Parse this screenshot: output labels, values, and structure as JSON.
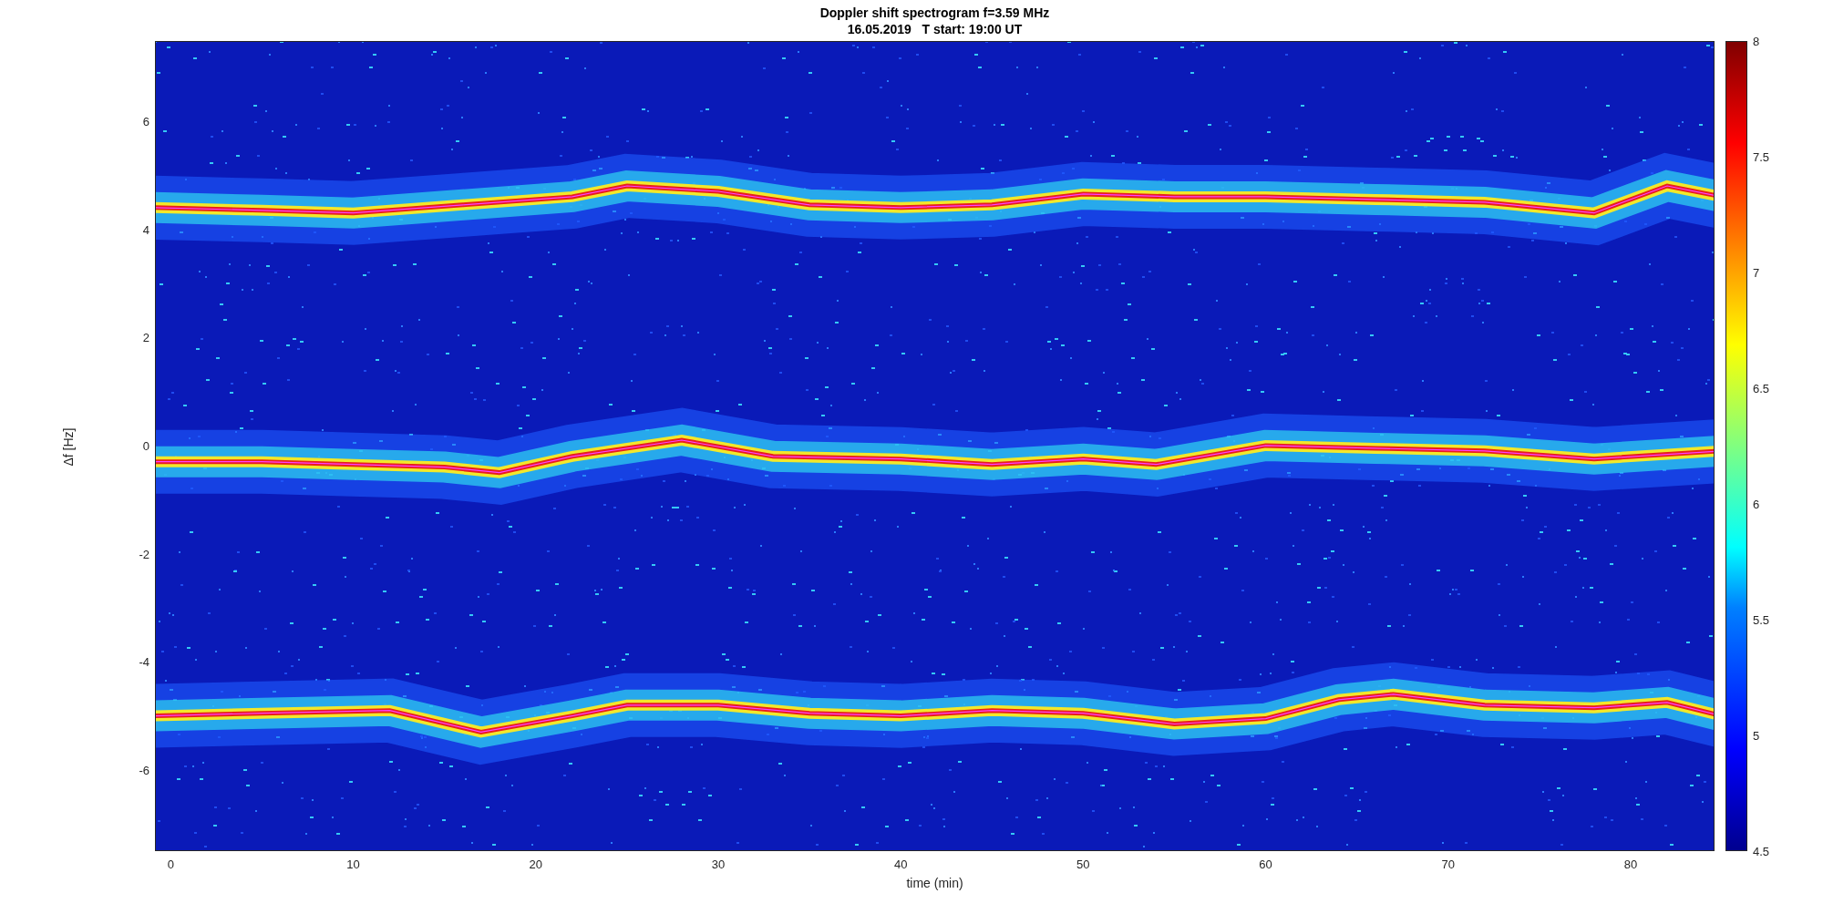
{
  "title": {
    "line_1": "Doppler shift spectrogram f=3.59 MHz",
    "line_2": "16.05.2019   T start: 19:00 UT"
  },
  "y_axis": {
    "label": "Δf [Hz]",
    "ticks": [
      "6",
      "4",
      "2",
      "0",
      "-2",
      "-4",
      "-6"
    ]
  },
  "x_axis": {
    "label": "time (min)",
    "ticks": [
      "0",
      "10",
      "20",
      "30",
      "40",
      "50",
      "60",
      "70",
      "80"
    ]
  },
  "colorbar": {
    "ticks": [
      "8",
      "7.5",
      "7",
      "6.5",
      "6",
      "5.5",
      "5",
      "4.5"
    ]
  }
}
